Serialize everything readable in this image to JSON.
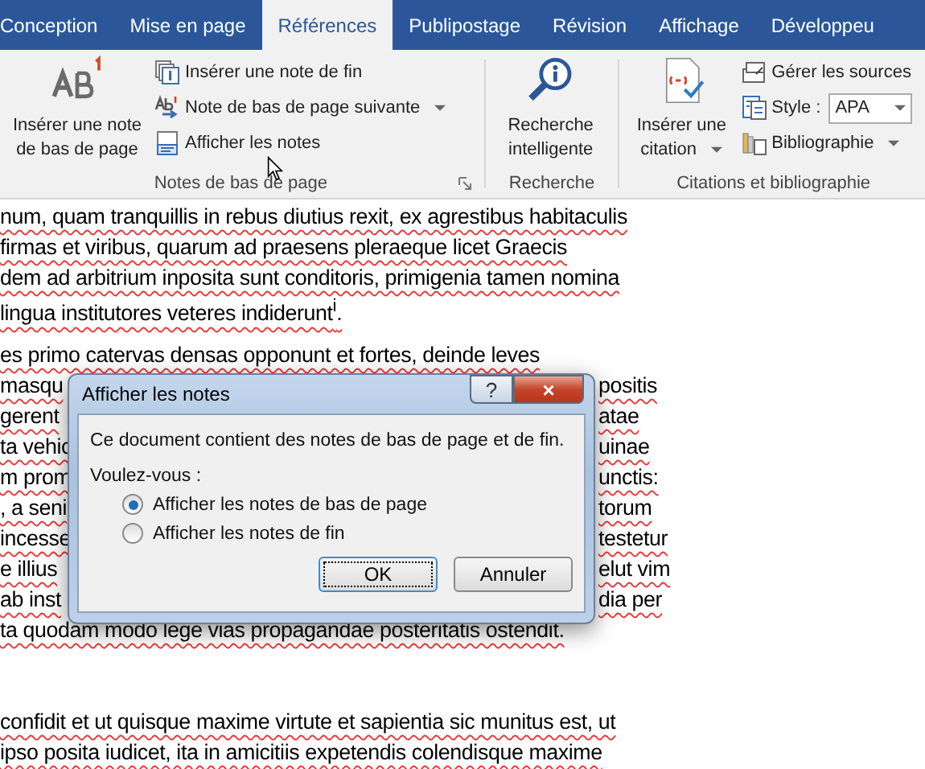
{
  "tabs": [
    {
      "label": "Conception",
      "selected": false
    },
    {
      "label": "Mise en page",
      "selected": false
    },
    {
      "label": "Références",
      "selected": true
    },
    {
      "label": "Publipostage",
      "selected": false
    },
    {
      "label": "Révision",
      "selected": false
    },
    {
      "label": "Affichage",
      "selected": false
    },
    {
      "label": "Développeu",
      "selected": false
    }
  ],
  "ribbon": {
    "footnotes": {
      "big_button": "Insérer une note de bas de page",
      "items": [
        "Insérer une note de fin",
        "Note de bas de page suivante",
        "Afficher les notes"
      ],
      "label": "Notes de bas de page"
    },
    "research": {
      "big_button": "Recherche intelligente",
      "label": "Recherche"
    },
    "citations": {
      "big_button": "Insérer une citation",
      "manage": "Gérer les sources",
      "style_label": "Style :",
      "style_value": "APA",
      "bibliography": "Bibliographie",
      "label": "Citations et bibliographie"
    }
  },
  "document": {
    "paragraphs": [
      {
        "lines": [
          {
            "kind": "full",
            "text": "num, quam tranquillis in rebus diutius rexit, ex agrestibus habitaculis"
          },
          {
            "kind": "full",
            "text": "firmas et viribus, quarum ad praesens pleraeque licet Graecis"
          },
          {
            "kind": "full",
            "text": "dem ad arbitrium inposita sunt conditoris, primigenia tamen nomina"
          },
          {
            "kind": "full",
            "text": "lingua institutores veteres indiderunt$^{i}$."
          }
        ]
      },
      {
        "lines": [
          {
            "kind": "full",
            "text": "es primo catervas densas opponunt et fortes, deinde leves"
          },
          {
            "kind": "split",
            "left": "masqu",
            "right": "positis"
          },
          {
            "kind": "split",
            "left": "gerent",
            "right": "atae"
          },
          {
            "kind": "split",
            "left": "ta vehic",
            "right": "uinae"
          },
          {
            "kind": "split",
            "left": "m prom",
            "right": "unctis:"
          },
          {
            "kind": "split",
            "left": ", a seni",
            "right": "torum"
          },
          {
            "kind": "split",
            "left": "incesse",
            "right": "testetur"
          },
          {
            "kind": "split",
            "left": "e illius",
            "right": "elut vim"
          },
          {
            "kind": "split",
            "left": "ab inst",
            "right": "dia per"
          },
          {
            "kind": "full",
            "text": "ta quodam modo lege vias propagandae posteritatis ostendit."
          }
        ]
      },
      {
        "lines": [
          {
            "kind": "full",
            "text": "confidit et ut quisque maxime virtute et sapientia sic munitus est, ut"
          },
          {
            "kind": "full",
            "text": "ipso posita iudicet, ita in amicitiis expetendis colendisque maxime"
          }
        ]
      }
    ]
  },
  "dialog": {
    "title": "Afficher les notes",
    "help": "?",
    "close": "×",
    "message": "Ce document contient des notes de bas de page et de fin.",
    "prompt": "Voulez-vous :",
    "options": [
      {
        "label": "Afficher les notes de bas de page",
        "selected": true
      },
      {
        "label": "Afficher les notes de fin",
        "selected": false
      }
    ],
    "buttons": [
      "OK",
      "Annuler"
    ]
  }
}
